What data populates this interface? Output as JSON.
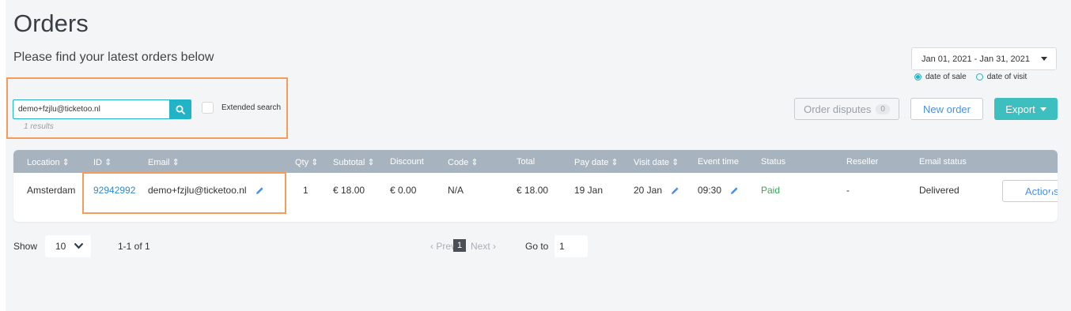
{
  "page": {
    "title": "Orders",
    "subtitle": "Please find your latest orders below"
  },
  "search": {
    "value": "demo+fzjlu@ticketoo.nl",
    "extended_label": "Extended search",
    "results_text": "1 results"
  },
  "date_filter": {
    "range": "Jan 01, 2021 - Jan 31, 2021",
    "options": [
      {
        "label": "date of sale",
        "selected": true
      },
      {
        "label": "date of visit",
        "selected": false
      }
    ]
  },
  "toolbar": {
    "disputes_label": "Order disputes",
    "disputes_count": "0",
    "new_order_label": "New order",
    "export_label": "Export"
  },
  "table": {
    "columns": [
      {
        "key": "location",
        "label": "Location",
        "sortable": true
      },
      {
        "key": "id",
        "label": "ID",
        "sortable": true
      },
      {
        "key": "email",
        "label": "Email",
        "sortable": true
      },
      {
        "key": "qty",
        "label": "Qty",
        "sortable": true
      },
      {
        "key": "subtotal",
        "label": "Subtotal",
        "sortable": true
      },
      {
        "key": "discount",
        "label": "Discount",
        "sortable": false
      },
      {
        "key": "code",
        "label": "Code",
        "sortable": true
      },
      {
        "key": "total",
        "label": "Total",
        "sortable": false
      },
      {
        "key": "pay_date",
        "label": "Pay date",
        "sortable": true
      },
      {
        "key": "visit_date",
        "label": "Visit date",
        "sortable": true
      },
      {
        "key": "event_time",
        "label": "Event time",
        "sortable": false
      },
      {
        "key": "status",
        "label": "Status",
        "sortable": false
      },
      {
        "key": "reseller",
        "label": "Reseller",
        "sortable": false
      },
      {
        "key": "email_status",
        "label": "Email status",
        "sortable": false
      }
    ],
    "sort_glyph": "⇕",
    "rows": [
      {
        "location": "Amsterdam",
        "id": "92942992",
        "email": "demo+fzjlu@ticketoo.nl",
        "qty": "1",
        "subtotal": "€ 18.00",
        "discount": "€ 0.00",
        "code": "N/A",
        "total": "€ 18.00",
        "pay_date": "19 Jan",
        "visit_date": "20 Jan",
        "event_time": "09:30",
        "status": "Paid",
        "reseller": "-",
        "email_status": "Delivered",
        "actions_label": "Actions"
      }
    ]
  },
  "pagination": {
    "show_label": "Show",
    "page_size": "10",
    "range_text": "1-1 of 1",
    "prev_label": "‹ Prev",
    "current_page": "1",
    "next_label": "Next ›",
    "goto_label": "Go to",
    "goto_value": "1"
  },
  "colors": {
    "accent": "#22b3c6",
    "export": "#3dbfbf",
    "header_bg": "#a7b3bf",
    "highlight": "#f39c5b",
    "link": "#2a8bd1",
    "paid": "#3aa655"
  }
}
